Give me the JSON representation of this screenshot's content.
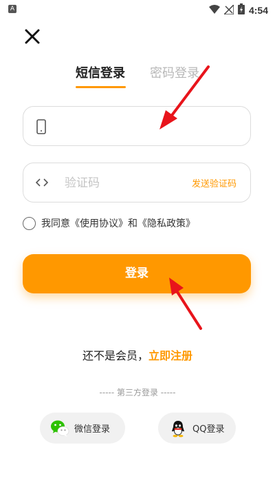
{
  "status_bar": {
    "left_icon": "A",
    "time": "4:54",
    "icons": [
      "wifi-icon",
      "no-signal-icon",
      "battery-icon"
    ]
  },
  "tabs": {
    "sms_login": "短信登录",
    "password_login": "密码登录"
  },
  "phone_field": {
    "placeholder": "",
    "value": ""
  },
  "code_field": {
    "placeholder": "验证码",
    "value": "",
    "send_code": "发送验证码"
  },
  "agreement": {
    "text": "我同意《使用协议》和《隐私政策》",
    "checked": false
  },
  "login_button": "登录",
  "register": {
    "prompt": "还不是会员，",
    "link": "立即注册"
  },
  "third_party": {
    "divider": "----- 第三方登录 -----",
    "wechat": "微信登录",
    "qq": "QQ登录"
  },
  "colors": {
    "accent": "#ff9800",
    "annotation": "#e8141b"
  }
}
